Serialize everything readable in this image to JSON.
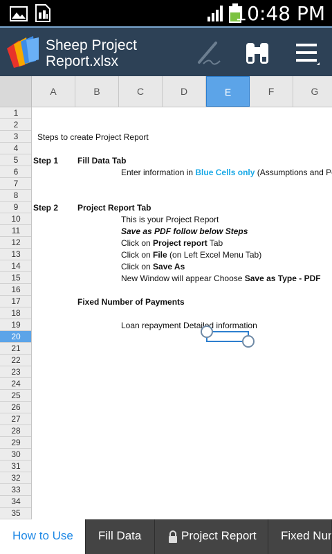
{
  "status_bar": {
    "time": "10:48 PM",
    "icons": [
      "image-icon",
      "sim-card-icon",
      "signal-icon",
      "battery-icon"
    ]
  },
  "action_bar": {
    "title_line1": "Sheep Project",
    "title_line2": "Report.xlsx",
    "buttons": [
      "pen-icon",
      "binoculars-icon",
      "menu-icon"
    ]
  },
  "columns": [
    "A",
    "B",
    "C",
    "D",
    "E",
    "F",
    "G"
  ],
  "selected_column": "E",
  "rows": [
    "1",
    "2",
    "3",
    "4",
    "5",
    "6",
    "7",
    "8",
    "9",
    "10",
    "11",
    "12",
    "13",
    "14",
    "15",
    "16",
    "17",
    "18",
    "19",
    "20",
    "21",
    "22",
    "23",
    "24",
    "25",
    "26",
    "27",
    "28",
    "29",
    "30",
    "31",
    "32",
    "33",
    "34",
    "35"
  ],
  "selected_row": "20",
  "cells": {
    "r3": "Steps to create Project Report",
    "r5_step": "Step 1",
    "r5_tab": "Fill Data Tab",
    "r6_pre": "Enter information in ",
    "r6_blue": "Blue Cells only",
    "r6_post": " (Assumptions and Personal Data)",
    "r9_step": "Step 2",
    "r9_tab": "Project Report Tab",
    "r10": "This is your Project Report",
    "r11": "Save as PDF follow below Steps",
    "r12_pre": "Click on ",
    "r12_bold": "Project report",
    "r12_post": " Tab",
    "r13_pre": "Click on ",
    "r13_bold": "File",
    "r13_post": " (on Left Excel Menu Tab)",
    "r14_pre": "Click on ",
    "r14_bold": "Save As",
    "r15_pre": "New Window will appear Choose ",
    "r15_bold": "Save as Type - PDF",
    "r17": "Fixed Number of Payments",
    "r19": "Loan repayment Detailed information"
  },
  "sheet_tabs": {
    "tab1": "How to Use",
    "tab2": "Fill Data",
    "tab3": "Project Report",
    "tab4": "Fixed Number of Payments"
  },
  "colors": {
    "action_bar": "#2d4156",
    "selection": "#5ca4e8",
    "active_tab_text": "#1e88e5",
    "blue_cells_text": "#19a8e6"
  }
}
